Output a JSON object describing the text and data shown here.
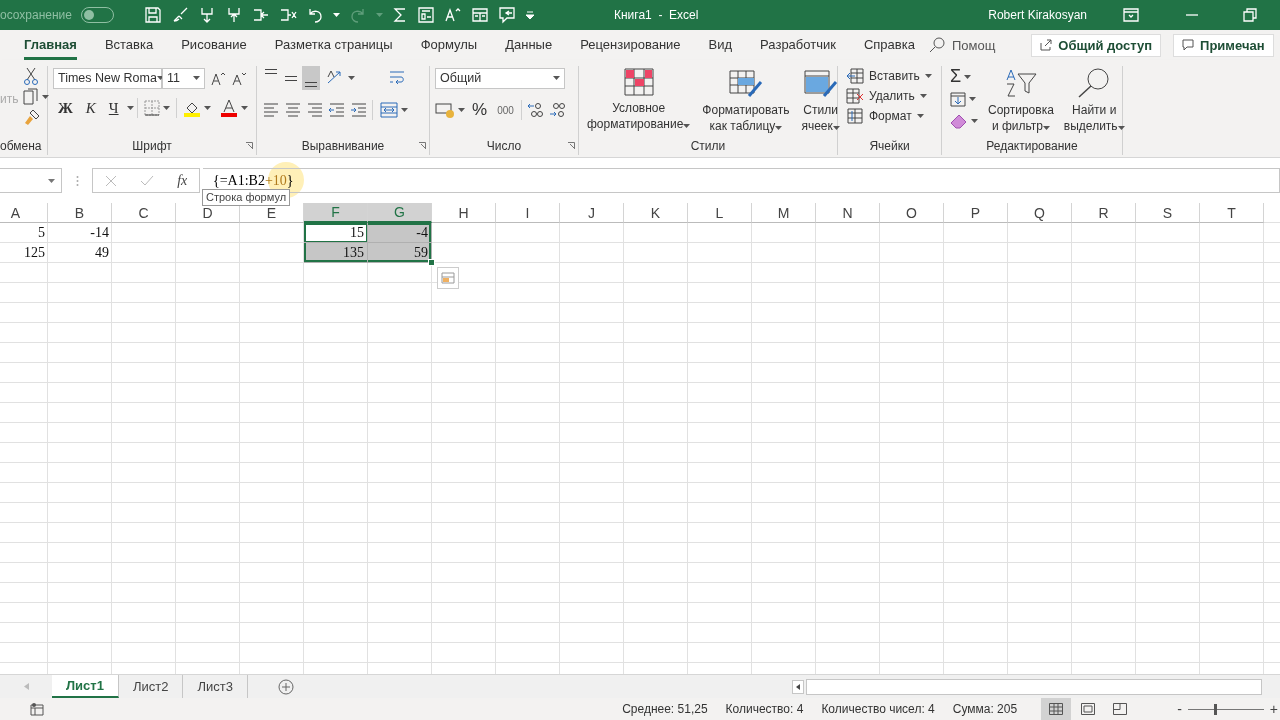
{
  "title_bar": {
    "autosave_label": "осохранение",
    "autosave_on": false,
    "title": "Книга1  -  Excel",
    "user": "Robert Kirakosyan"
  },
  "ribbon_tabs": [
    {
      "label": "Главная",
      "selected": true
    },
    {
      "label": "Вставка",
      "selected": false
    },
    {
      "label": "Рисование",
      "selected": false
    },
    {
      "label": "Разметка страницы",
      "selected": false
    },
    {
      "label": "Формулы",
      "selected": false
    },
    {
      "label": "Данные",
      "selected": false
    },
    {
      "label": "Рецензирование",
      "selected": false
    },
    {
      "label": "Вид",
      "selected": false
    },
    {
      "label": "Разработчик",
      "selected": false
    },
    {
      "label": "Справка",
      "selected": false
    }
  ],
  "tell_me": "Помощ",
  "share_button": "Общий доступ",
  "comments_button": "Примечан",
  "ribbon": {
    "clipboard": {
      "paste_label": "ить",
      "label": "обмена"
    },
    "font": {
      "font_name": "Times New Roma",
      "font_size": "11",
      "style_buttons": [
        "Ж",
        "К",
        "Ч"
      ],
      "label": "Шрифт"
    },
    "alignment": {
      "vertical": [
        {
          "selected": false
        },
        {
          "selected": false
        },
        {
          "selected": true
        }
      ],
      "label": "Выравнивание"
    },
    "number": {
      "format": "Общий",
      "percent": "%",
      "thousands": "000",
      "label": "Число"
    },
    "styles": {
      "buttons": [
        "Условное\nформатирование",
        "Форматировать\nкак таблицу",
        "Стили\nячеек"
      ],
      "label": "Стили"
    },
    "cells": {
      "buttons": [
        "Вставить",
        "Удалить",
        "Формат"
      ],
      "label": "Ячейки"
    },
    "editing": {
      "sum": "Σ",
      "buttons": [
        "Сортировка\nи фильтр",
        "Найти и\nвыделить"
      ],
      "label": "Редактирование"
    }
  },
  "formula_bar": {
    "function_label": "fx",
    "formula": "{=A1:B2",
    "formula_highlight": "+10",
    "formula_end": "}",
    "tooltip": "Строка формул"
  },
  "sheet": {
    "columns": [
      {
        "label": "A",
        "selected": false
      },
      {
        "label": "B",
        "selected": false
      },
      {
        "label": "C",
        "selected": false
      },
      {
        "label": "D",
        "selected": false
      },
      {
        "label": "E",
        "selected": false
      },
      {
        "label": "F",
        "selected": true
      },
      {
        "label": "G",
        "selected": true
      },
      {
        "label": "H",
        "selected": false
      },
      {
        "label": "I",
        "selected": false
      },
      {
        "label": "J",
        "selected": false
      },
      {
        "label": "K",
        "selected": false
      },
      {
        "label": "L",
        "selected": false
      },
      {
        "label": "M",
        "selected": false
      },
      {
        "label": "N",
        "selected": false
      },
      {
        "label": "O",
        "selected": false
      },
      {
        "label": "P",
        "selected": false
      },
      {
        "label": "Q",
        "selected": false
      },
      {
        "label": "R",
        "selected": false
      },
      {
        "label": "S",
        "selected": false
      },
      {
        "label": "T",
        "selected": false
      }
    ],
    "rows": [
      {
        "cells": [
          {
            "value": "5",
            "selected": false,
            "active": false
          },
          {
            "value": "-14",
            "selected": false,
            "active": false
          },
          {
            "selected": false,
            "active": false
          },
          {
            "selected": false,
            "active": false
          },
          {
            "selected": false,
            "active": false
          },
          {
            "value": "15",
            "selected": true,
            "active": true
          },
          {
            "value": "-4",
            "selected": true,
            "active": false
          }
        ]
      },
      {
        "cells": [
          {
            "value": "125",
            "selected": false,
            "active": false
          },
          {
            "value": "49",
            "selected": false,
            "active": false
          },
          {
            "selected": false,
            "active": false
          },
          {
            "selected": false,
            "active": false
          },
          {
            "selected": false,
            "active": false
          },
          {
            "value": "135",
            "selected": true,
            "active": false
          },
          {
            "value": "59",
            "selected": true,
            "active": false
          }
        ]
      }
    ]
  },
  "sheet_tabs": [
    {
      "label": "Лист1",
      "selected": true
    },
    {
      "label": "Лист2",
      "selected": false
    },
    {
      "label": "Лист3",
      "selected": false
    }
  ],
  "status_bar": {
    "stats": [
      "Среднее: 51,25",
      "Количество: 4",
      "Количество чисел: 4",
      "Сумма: 205"
    ],
    "views": [
      {
        "selected": true
      },
      {
        "selected": false
      },
      {
        "selected": false
      }
    ],
    "zoom_out": "-",
    "zoom_in": "+",
    "zoom": {
      "level": 0.35
    }
  }
}
